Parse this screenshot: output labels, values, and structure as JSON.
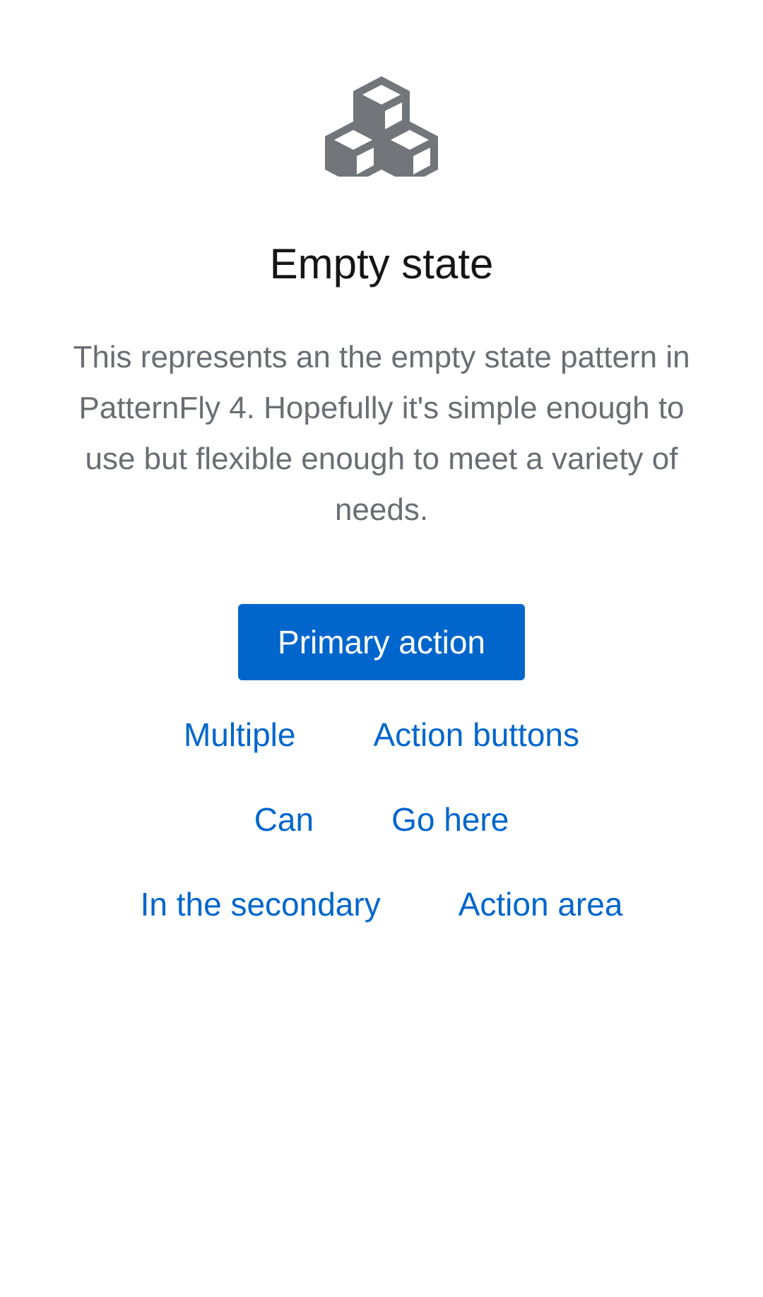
{
  "empty_state": {
    "icon": "cubes-icon",
    "title": "Empty state",
    "body": "This represents an the empty state pattern in PatternFly 4. Hopefully it's simple enough to use but flexible enough to meet a variety of needs.",
    "primary_action": "Primary action",
    "secondary_actions": [
      [
        "Multiple",
        "Action buttons"
      ],
      [
        "Can",
        "Go here"
      ],
      [
        "In the secondary",
        "Action area"
      ]
    ]
  },
  "colors": {
    "primary": "#0066cc",
    "title": "#151515",
    "body": "#6a6e73",
    "icon": "#72767b",
    "background": "#ffffff"
  }
}
